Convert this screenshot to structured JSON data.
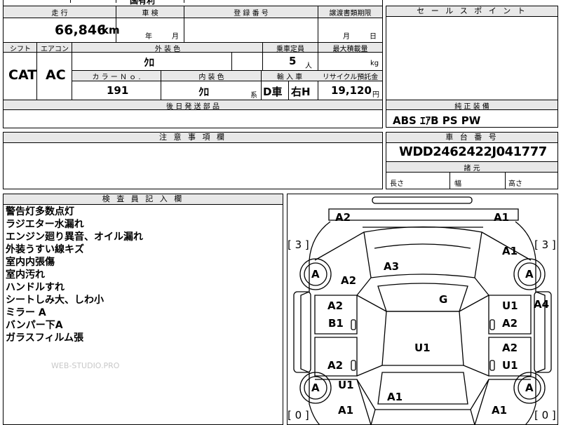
{
  "top_row_fragments": {
    "left": "国有利",
    "right": "..."
  },
  "mileage": {
    "label": "走 行",
    "value": "66,846",
    "unit": "km"
  },
  "inspection": {
    "label": "車 検",
    "year_unit": "年",
    "month_unit": "月",
    "value": ""
  },
  "registration": {
    "label": "登 録 番 号",
    "value": ""
  },
  "transfer_deadline": {
    "label": "譲渡書類期限",
    "month_unit": "月",
    "day_unit": "日"
  },
  "sales_point": {
    "label": "セ ー ル ス ポ イ ン ト",
    "value": ""
  },
  "shift": {
    "label": "シフト",
    "value": "CAT"
  },
  "aircon": {
    "label": "エアコン",
    "value": "AC"
  },
  "exterior_color": {
    "label": "外 装 色",
    "value": "ｸﾛ"
  },
  "capacity": {
    "label": "乗車定員",
    "value": "5",
    "unit": "人"
  },
  "max_load": {
    "label": "最大積載量",
    "value": "",
    "unit": "kg"
  },
  "color_no": {
    "label": "カ ラ ー Ｎ ｏ .",
    "value": "191"
  },
  "interior_color": {
    "label": "内 装 色",
    "value": "ｸﾛ",
    "suffix": "系"
  },
  "import": {
    "label": "輸 入 車",
    "value1": "D車",
    "value2": "右H"
  },
  "recycle_fee": {
    "label": "リサイクル預託金",
    "value": "19,120",
    "unit": "円"
  },
  "later_parts": {
    "label": "後 日 発 送 部 品",
    "value": ""
  },
  "standard_equipment": {
    "label": "純 正 装 備",
    "value": "ABS ｴｱB PS PW"
  },
  "notes_section": {
    "label": "注 意 事 項 欄",
    "value": ""
  },
  "chassis_number": {
    "label": "車 台 番 号",
    "value": "WDD2462422J041777"
  },
  "dimensions": {
    "label": "諸 元",
    "length": "長さ",
    "width": "幅",
    "height": "高さ"
  },
  "inspector_notes": {
    "label": "検 査 員 記 入 欄",
    "lines": [
      "警告灯多数点灯",
      "ラジエター水漏れ",
      "エンジン廻り異音、オイル漏れ",
      "外装うすい線キズ",
      "室内内張傷",
      "室内汚れ",
      "ハンドルすれ",
      "シートしみ大、しわ小",
      "ミラー A",
      "バンパー下A",
      "ガラスフィルム張"
    ],
    "watermark": "WEB-STUDIO.PRO"
  },
  "diagram": {
    "marks": {
      "front_left_bumper": "A2",
      "front_right_bumper": "A1",
      "left_window_score": "[ 3 ]",
      "right_window_score": "[ 3 ]",
      "right_front_fender": "A1",
      "hood": "A3",
      "left_front_fender": "A2",
      "front_left_tire": "A",
      "front_right_tire": "A",
      "left_front_door": "A2",
      "left_front_door_2": "B1",
      "roof": "G",
      "right_front_door": "U1",
      "right_front_door_2": "A2",
      "right_side": "A4",
      "trunk_area": "U1",
      "left_rear_door": "A2",
      "right_rear_door": "A2",
      "right_rear_door_2": "U1",
      "rear_left_tire": "A",
      "rear_right_tire": "A",
      "left_rear_quarter": "U1",
      "rear_center": "A1",
      "rear_left_bumper": "A1",
      "rear_right_bumper": "A1",
      "rear_left_score": "[ 0 ]",
      "rear_right_score": "[ 0 ]"
    }
  }
}
